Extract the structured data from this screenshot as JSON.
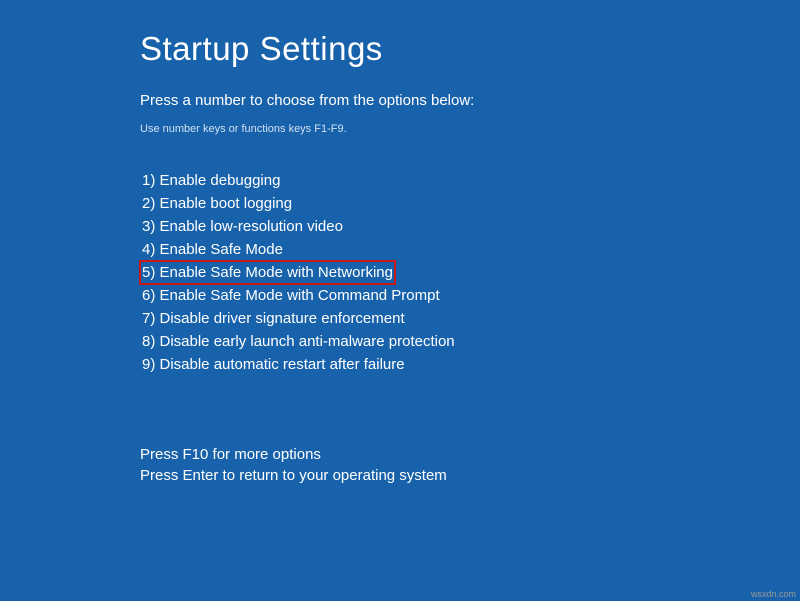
{
  "title": "Startup Settings",
  "instruction": "Press a number to choose from the options below:",
  "hint": "Use number keys or functions keys F1-F9.",
  "options": [
    {
      "label": "1) Enable debugging",
      "highlighted": false
    },
    {
      "label": "2) Enable boot logging",
      "highlighted": false
    },
    {
      "label": "3) Enable low-resolution video",
      "highlighted": false
    },
    {
      "label": "4) Enable Safe Mode",
      "highlighted": false
    },
    {
      "label": "5) Enable Safe Mode with Networking",
      "highlighted": true
    },
    {
      "label": "6) Enable Safe Mode with Command Prompt",
      "highlighted": false
    },
    {
      "label": "7) Disable driver signature enforcement",
      "highlighted": false
    },
    {
      "label": "8) Disable early launch anti-malware protection",
      "highlighted": false
    },
    {
      "label": "9) Disable automatic restart after failure",
      "highlighted": false
    }
  ],
  "footer": {
    "more": "Press F10 for more options",
    "return": "Press Enter to return to your operating system"
  },
  "watermark": "wsxdn.com",
  "colors": {
    "background": "#1862ab",
    "highlight_border": "#c81818"
  }
}
